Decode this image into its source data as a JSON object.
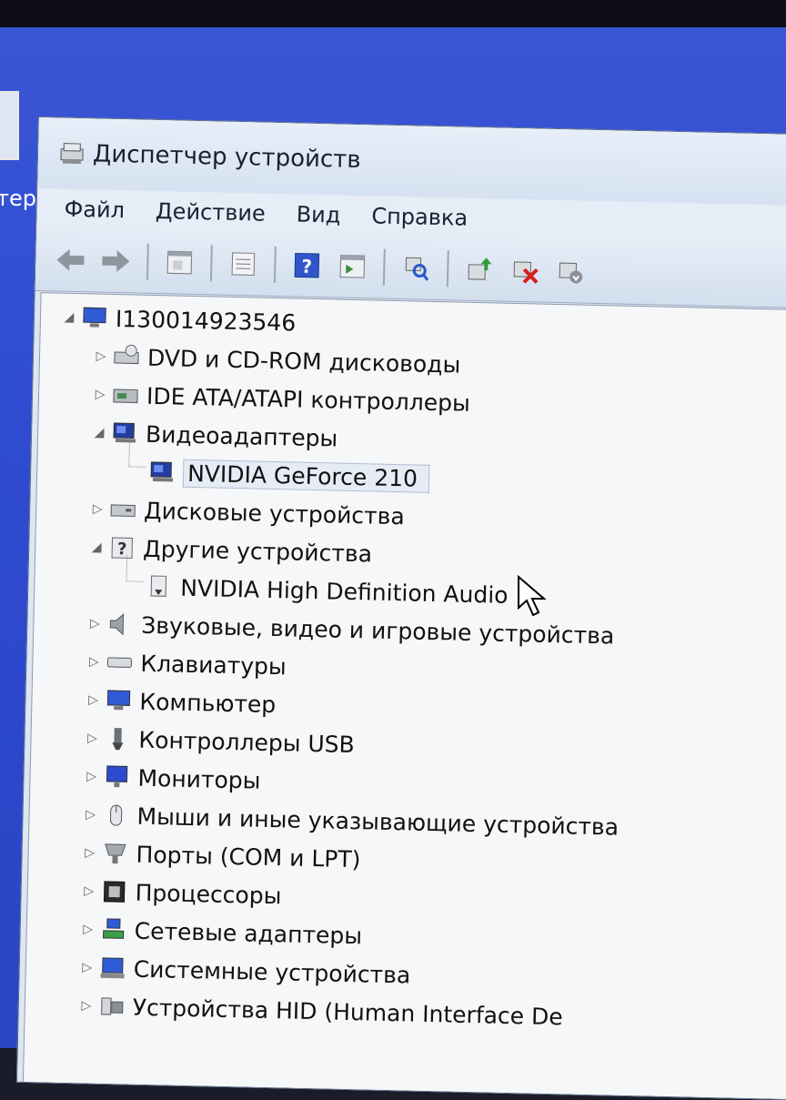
{
  "desktop": {
    "label_fragment": "тер"
  },
  "window": {
    "title": "Диспетчер устройств",
    "menu": [
      "Файл",
      "Действие",
      "Вид",
      "Справка"
    ]
  },
  "toolbar": {
    "buttons": [
      "back-icon",
      "forward-icon",
      "up-pane-icon",
      "properties-icon",
      "help-icon",
      "show-hide-icon",
      "scan-icon",
      "update-driver-icon",
      "uninstall-icon",
      "disable-icon"
    ]
  },
  "tree": {
    "root": "I130014923546",
    "items": [
      {
        "label": "DVD и CD-ROM дисководы",
        "icon": "dvd-drive-icon",
        "expanded": false
      },
      {
        "label": "IDE ATA/ATAPI контроллеры",
        "icon": "ide-controller-icon",
        "expanded": false
      },
      {
        "label": "Видеоадаптеры",
        "icon": "display-adapter-icon",
        "expanded": true,
        "children": [
          {
            "label": "NVIDIA GeForce 210",
            "icon": "display-adapter-icon",
            "selected": true
          }
        ]
      },
      {
        "label": "Дисковые устройства",
        "icon": "disk-drive-icon",
        "expanded": false
      },
      {
        "label": "Другие устройства",
        "icon": "unknown-device-icon",
        "expanded": true,
        "children": [
          {
            "label": "NVIDIA High Definition Audio",
            "icon": "warning-device-icon",
            "selected": false
          }
        ]
      },
      {
        "label": "Звуковые, видео и игровые устройства",
        "icon": "speaker-icon",
        "expanded": false
      },
      {
        "label": "Клавиатуры",
        "icon": "keyboard-icon",
        "expanded": false
      },
      {
        "label": "Компьютер",
        "icon": "computer-icon",
        "expanded": false
      },
      {
        "label": "Контроллеры USB",
        "icon": "usb-icon",
        "expanded": false
      },
      {
        "label": "Мониторы",
        "icon": "monitor-icon",
        "expanded": false
      },
      {
        "label": "Мыши и иные указывающие устройства",
        "icon": "mouse-icon",
        "expanded": false
      },
      {
        "label": "Порты (COM и LPT)",
        "icon": "port-icon",
        "expanded": false
      },
      {
        "label": "Процессоры",
        "icon": "processor-icon",
        "expanded": false
      },
      {
        "label": "Сетевые адаптеры",
        "icon": "network-adapter-icon",
        "expanded": false
      },
      {
        "label": "Системные устройства",
        "icon": "system-device-icon",
        "expanded": false
      },
      {
        "label": "Устройства HID (Human Interface De",
        "icon": "hid-icon",
        "expanded": false
      }
    ]
  },
  "colors": {
    "desktop": "#2f4bd0",
    "window": "#dde7f3",
    "tree_bg": "#f6f7f9"
  }
}
